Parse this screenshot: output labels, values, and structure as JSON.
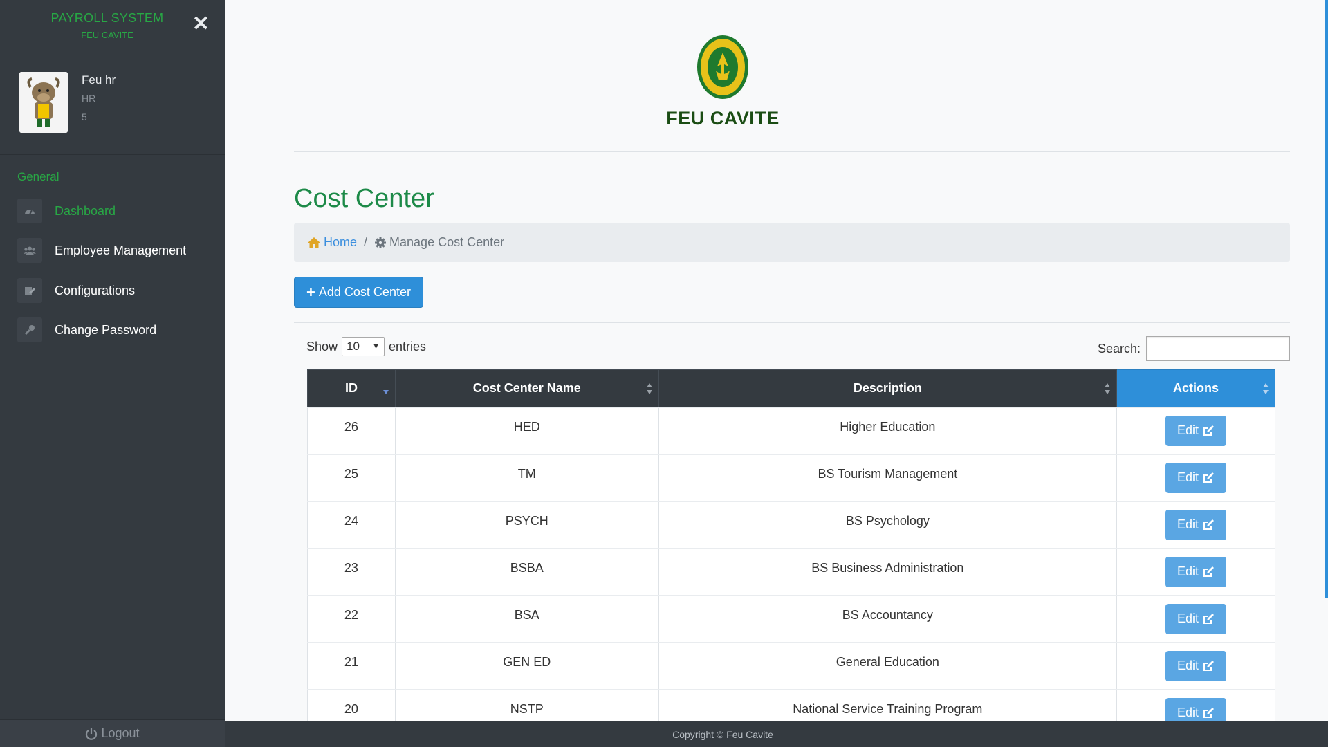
{
  "sidebar": {
    "brand_title": "PAYROLL SYSTEM",
    "brand_sub": "FEU CAVITE",
    "close_symbol": "✕",
    "profile": {
      "name": "Feu hr",
      "role": "HR",
      "number": "5"
    },
    "section": "General",
    "items": [
      {
        "label": "Dashboard",
        "icon": "dashboard-icon",
        "active": true
      },
      {
        "label": "Employee Management",
        "icon": "users-icon",
        "active": false
      },
      {
        "label": "Configurations",
        "icon": "config-icon",
        "active": false
      },
      {
        "label": "Change Password",
        "icon": "key-icon",
        "active": false
      }
    ],
    "logout_label": "Logout"
  },
  "header": {
    "logo_text": "FEU CAVITE"
  },
  "page": {
    "title": "Cost Center",
    "breadcrumb": {
      "home": "Home",
      "separator": "/",
      "current": "Manage Cost Center"
    },
    "add_button": "Add Cost Center",
    "show_label": "Show",
    "entries_value": "10",
    "entries_label": "entries",
    "search_label": "Search:",
    "search_value": ""
  },
  "table": {
    "columns": [
      "ID",
      "Cost Center Name",
      "Description",
      "Actions"
    ],
    "rows": [
      {
        "id": "26",
        "name": "HED",
        "description": "Higher Education",
        "action": "Edit"
      },
      {
        "id": "25",
        "name": "TM",
        "description": "BS Tourism Management",
        "action": "Edit"
      },
      {
        "id": "24",
        "name": "PSYCH",
        "description": "BS Psychology",
        "action": "Edit"
      },
      {
        "id": "23",
        "name": "BSBA",
        "description": "BS Business Administration",
        "action": "Edit"
      },
      {
        "id": "22",
        "name": "BSA",
        "description": "BS Accountancy",
        "action": "Edit"
      },
      {
        "id": "21",
        "name": "GEN ED",
        "description": "General Education",
        "action": "Edit"
      },
      {
        "id": "20",
        "name": "NSTP",
        "description": "National Service Training Program",
        "action": "Edit"
      }
    ]
  },
  "footer": {
    "copyright": "Copyright © Feu Cavite"
  },
  "colors": {
    "accent_green": "#28a745",
    "primary_blue": "#2e8fd9",
    "sidebar_bg": "#343a40"
  }
}
